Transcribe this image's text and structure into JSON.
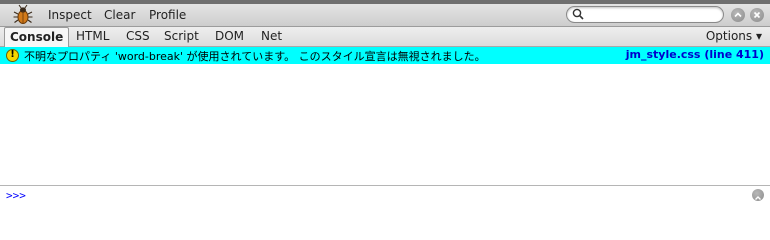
{
  "toolbar": {
    "logo_icon": "firebug-icon",
    "buttons": [
      "Inspect",
      "Clear",
      "Profile"
    ],
    "search_placeholder": ""
  },
  "tabs": {
    "items": [
      "Console",
      "HTML",
      "CSS",
      "Script",
      "DOM",
      "Net"
    ],
    "active": "Console",
    "options_label": "Options ▾"
  },
  "console": {
    "row_color": "#00ffff",
    "entries": [
      {
        "type": "warning",
        "icon": "warning-icon",
        "icon_glyph": "!",
        "message": "不明なプロパティ 'word-break' が使用されています。 このスタイル宣言は無視されました。",
        "source": "jm_style.css (line 411)"
      }
    ]
  },
  "command_line": {
    "prompt": ">>>",
    "value": ""
  }
}
